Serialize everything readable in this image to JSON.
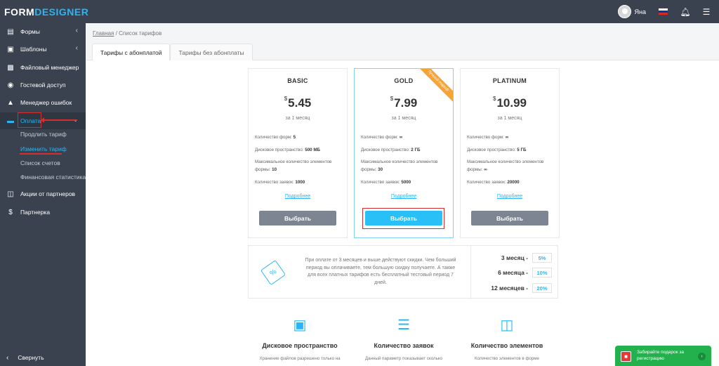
{
  "brand": {
    "part1": "FORM",
    "part2": "DESIGNER"
  },
  "header": {
    "user_name": "Яна",
    "flag_colors": [
      "#ffffff",
      "#0039a6",
      "#d52b1e"
    ],
    "bell_icon": "bell-icon",
    "menu_icon": "hamburger-icon"
  },
  "sidebar": {
    "items": [
      {
        "label": "Формы",
        "icon": "forms-icon"
      },
      {
        "label": "Шаблоны",
        "icon": "templates-icon"
      },
      {
        "label": "Файловый менеджер",
        "icon": "folder-icon"
      },
      {
        "label": "Гостевой доступ",
        "icon": "guest-icon"
      },
      {
        "label": "Менеджер ошибок",
        "icon": "warning-icon"
      },
      {
        "label": "Оплата",
        "icon": "card-icon"
      },
      {
        "label": "Акции от партнеров",
        "icon": "gift-icon"
      },
      {
        "label": "Партнерка",
        "icon": "dollar-icon"
      }
    ],
    "subitems": [
      "Продлить тариф",
      "Изменить тариф",
      "Список счетов",
      "Финансовая статистика"
    ],
    "collapse_label": "Свернуть"
  },
  "breadcrumb": {
    "home": "Главная",
    "separator": "/",
    "current": "Список тарифов"
  },
  "tabs": [
    "Тарифы с абонплатой",
    "Тарифы без абонплаты"
  ],
  "plans": [
    {
      "name": "BASIC",
      "currency": "$",
      "price": "5.45",
      "period": "за 1 месяц",
      "specs": [
        {
          "label": "Количество форм:",
          "value": "5"
        },
        {
          "label": "Дисковое пространство:",
          "value": "500 МБ"
        },
        {
          "label": "Максимальное количество элементов формы:",
          "value": "10"
        },
        {
          "label": "Количество заявок:",
          "value": "1000"
        }
      ],
      "more": "Подробнее",
      "button": "Выбрать"
    },
    {
      "name": "GOLD",
      "currency": "$",
      "price": "7.99",
      "period": "за 1 месяц",
      "ribbon": "Лучший тариф",
      "specs": [
        {
          "label": "Количество форм:",
          "value": "∞"
        },
        {
          "label": "Дисковое пространство:",
          "value": "2 ГБ"
        },
        {
          "label": "Максимальное количество элементов формы:",
          "value": "30"
        },
        {
          "label": "Количество заявок:",
          "value": "5000"
        }
      ],
      "more": "Подробнее",
      "button": "Выбрать"
    },
    {
      "name": "PLATINUM",
      "currency": "$",
      "price": "10.99",
      "period": "за 1 месяц",
      "specs": [
        {
          "label": "Количество форм:",
          "value": "∞"
        },
        {
          "label": "Дисковое пространство:",
          "value": "5 ГБ"
        },
        {
          "label": "Максимальное количество элементов формы:",
          "value": "∞"
        },
        {
          "label": "Количество заявок:",
          "value": "20000"
        }
      ],
      "more": "Подробнее",
      "button": "Выбрать"
    }
  ],
  "discount": {
    "text": "При оплате от 3 месяцев и выше действуют скидки. Чем больший период вы оплачиваете, тем большую скидку получаете. А также для всех платных тарифов есть бесплатный тестовый период 7 дней.",
    "rows": [
      {
        "label": "3 месяц -",
        "value": "5%"
      },
      {
        "label": "6 месяца -",
        "value": "10%"
      },
      {
        "label": "12 месяцев -",
        "value": "20%"
      }
    ]
  },
  "features": [
    {
      "icon": "disk-icon",
      "title": "Дисковое пространство",
      "text": "Хранение файлов разрешено только на"
    },
    {
      "icon": "checklist-icon",
      "title": "Количество заявок",
      "text": "Данный параметр показывает сколько"
    },
    {
      "icon": "monitor-icon",
      "title": "Количество элементов",
      "text": "Количество элементов в форме"
    }
  ],
  "promo": {
    "text": "Забирайте подарок за регистрацию",
    "accent": "#22b14c"
  },
  "colors": {
    "accent": "#29b6f6",
    "sidebar": "#39424e",
    "ribbon": "#f7a335",
    "highlight": "#d32f2f"
  }
}
